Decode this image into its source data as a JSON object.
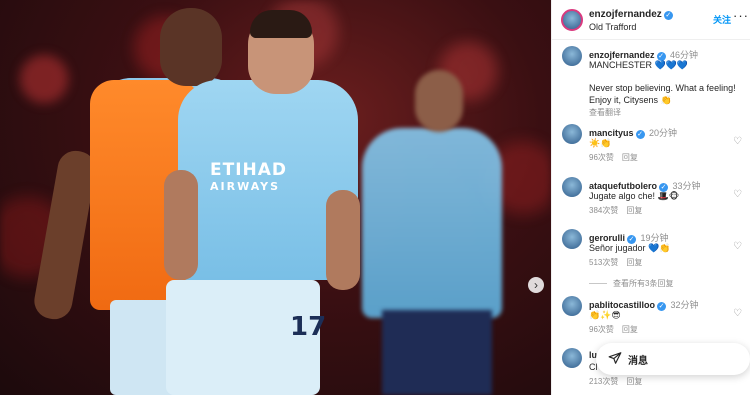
{
  "header": {
    "username": "enzojfernandez",
    "location": "Old Trafford",
    "follow_label": "关注",
    "more_label": "···"
  },
  "photo": {
    "sponsor_line1": "ETIHAD",
    "sponsor_line2": "AIRWAYS",
    "shirt_number": "17",
    "carousel_next": "›"
  },
  "caption": {
    "username": "enzojfernandez",
    "time": "46分钟",
    "line1": "MANCHESTER 💙💙💙",
    "line2": "Never stop believing. What a feeling!",
    "line3": "Enjoy it, Citysens 👏",
    "translate": "查看翻译"
  },
  "comments": [
    {
      "username": "mancityus",
      "time": "20分钟",
      "text": "☀️👏",
      "likes": "96次赞",
      "reply": "回复"
    },
    {
      "username": "ataquefutbolero",
      "time": "33分钟",
      "text": "Jugate algo che! 🎩🐵",
      "likes": "384次赞",
      "reply": "回复"
    },
    {
      "username": "gerorulli",
      "time": "19分钟",
      "text": "Señor jugador 💙👏",
      "likes": "513次赞",
      "reply": "回复"
    },
    {
      "username": "pablitocastilloo",
      "time": "32分钟",
      "text": "👏✨😎",
      "likes": "96次赞",
      "reply": "回复"
    },
    {
      "username": "lu",
      "time": "",
      "text": "Cl",
      "likes": "213次赞",
      "reply": "回复"
    }
  ],
  "view_replies": "查看所有3条回复",
  "messages": {
    "label": "消息"
  },
  "icons": {
    "heart": "heart-icon",
    "send": "paper-plane-icon",
    "verified": "verified-badge-icon"
  },
  "colors": {
    "link": "#0095f6",
    "verified": "#3897f0",
    "muted": "#8e8e8e"
  }
}
